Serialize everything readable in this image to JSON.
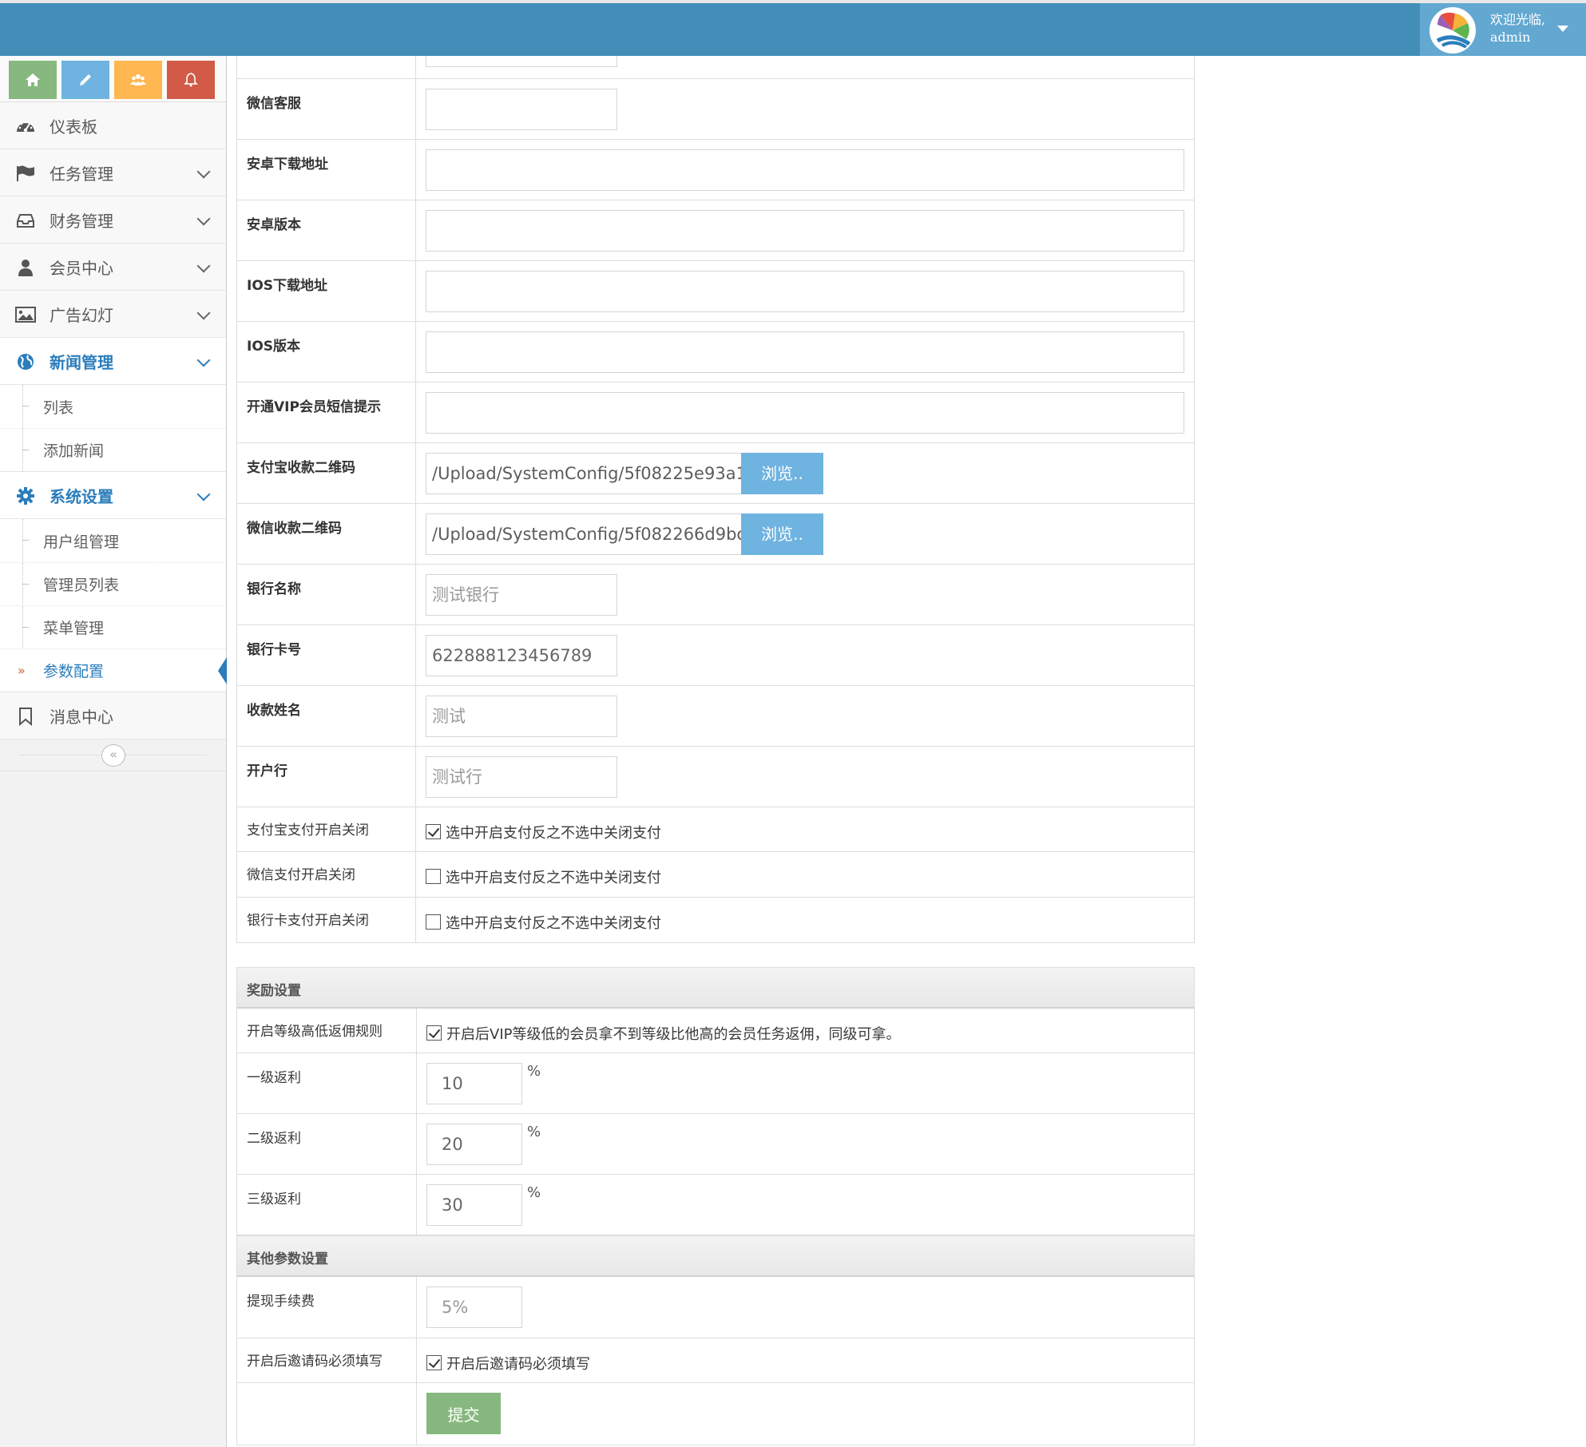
{
  "header": {
    "welcome": "欢迎光临,",
    "username": "admin"
  },
  "shortcuts": [
    {
      "icon": "home-icon",
      "color": "#87b87f"
    },
    {
      "icon": "pencil-icon",
      "color": "#6fb3e0"
    },
    {
      "icon": "users-icon",
      "color": "#ffb752"
    },
    {
      "icon": "bell-icon",
      "color": "#d15b47"
    }
  ],
  "sidebar": {
    "items": [
      {
        "label": "仪表板",
        "icon": "dashboard-icon"
      },
      {
        "label": "任务管理",
        "icon": "flag-icon"
      },
      {
        "label": "财务管理",
        "icon": "inbox-icon"
      },
      {
        "label": "会员中心",
        "icon": "user-icon"
      },
      {
        "label": "广告幻灯",
        "icon": "picture-icon"
      },
      {
        "label": "新闻管理",
        "icon": "globe-icon",
        "sub": [
          "列表",
          "添加新闻"
        ]
      },
      {
        "label": "系统设置",
        "icon": "cog-icon",
        "sub": [
          "用户组管理",
          "管理员列表",
          "菜单管理",
          "参数配置"
        ]
      },
      {
        "label": "消息中心",
        "icon": "bookmark-icon"
      }
    ],
    "collapse_glyph": "«"
  },
  "form": {
    "wechat_service": {
      "label": "微信客服",
      "value": ""
    },
    "android_url": {
      "label": "安卓下载地址",
      "value": ""
    },
    "android_version": {
      "label": "安卓版本",
      "value": ""
    },
    "ios_url": {
      "label": "IOS下载地址",
      "value": ""
    },
    "ios_version": {
      "label": "IOS版本",
      "value": ""
    },
    "vip_sms": {
      "label": "开通VIP会员短信提示",
      "value": ""
    },
    "alipay_qr": {
      "label": "支付宝收款二维码",
      "value": "/Upload/SystemConfig/5f08225e93a1",
      "button": "浏览.."
    },
    "wechat_qr": {
      "label": "微信收款二维码",
      "value": "/Upload/SystemConfig/5f082266d9bc",
      "button": "浏览.."
    },
    "bank_name": {
      "label": "银行名称",
      "value": "测试银行"
    },
    "bank_card": {
      "label": "银行卡号",
      "value": "622888123456789"
    },
    "payee_name": {
      "label": "收款姓名",
      "value": "测试"
    },
    "bank_branch": {
      "label": "开户行",
      "value": "测试行"
    },
    "alipay_toggle": {
      "label": "支付宝支付开启关闭",
      "text": "选中开启支付反之不选中关闭支付",
      "checked": true
    },
    "wechat_toggle": {
      "label": "微信支付开启关闭",
      "text": "选中开启支付反之不选中关闭支付",
      "checked": false
    },
    "bankcard_toggle": {
      "label": "银行卡支付开启关闭",
      "text": "选中开启支付反之不选中关闭支付",
      "checked": false
    }
  },
  "reward": {
    "title": "奖励设置",
    "level_rule": {
      "label": "开启等级高低返佣规则",
      "text": "开启后VIP等级低的会员拿不到等级比他高的会员任务返佣，同级可拿。",
      "checked": true
    },
    "level1": {
      "label": "一级返利",
      "value": "10",
      "unit": "%"
    },
    "level2": {
      "label": "二级返利",
      "value": "20",
      "unit": "%"
    },
    "level3": {
      "label": "三级返利",
      "value": "30",
      "unit": "%"
    }
  },
  "other": {
    "title": "其他参数设置",
    "fee": {
      "label": "提现手续费",
      "value": "5%"
    },
    "invite": {
      "label": "开启后邀请码必须填写",
      "text": "开启后邀请码必须填写",
      "checked": true
    },
    "submit": "提交"
  },
  "colors": {
    "navbar": "#438eb9",
    "accent": "#2b7dbc",
    "submit": "#87b87f",
    "browse": "#6fb3e0"
  }
}
